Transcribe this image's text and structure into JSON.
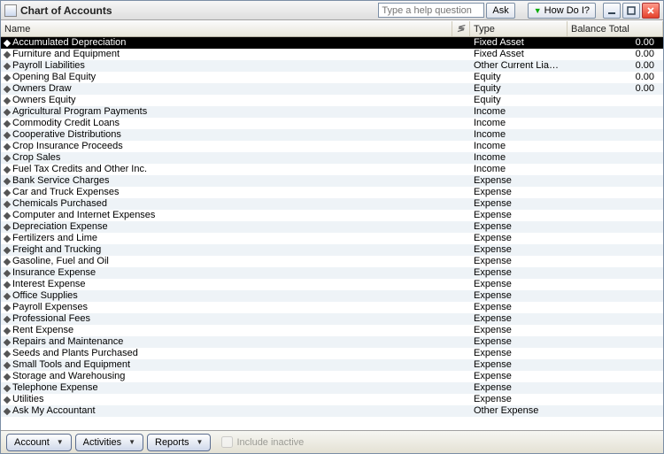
{
  "title": "Chart of Accounts",
  "help_placeholder": "Type a help question",
  "ask_label": "Ask",
  "howdo_label": "How Do I?",
  "columns": {
    "name": "Name",
    "type": "Type",
    "balance": "Balance Total"
  },
  "footer": {
    "account": "Account",
    "activities": "Activities",
    "reports": "Reports",
    "include_inactive": "Include inactive"
  },
  "accounts": [
    {
      "name": "Accumulated Depreciation",
      "type": "Fixed Asset",
      "balance": "0.00",
      "selected": true
    },
    {
      "name": "Furniture and Equipment",
      "type": "Fixed Asset",
      "balance": "0.00"
    },
    {
      "name": "Payroll Liabilities",
      "type": "Other Current Liabi...",
      "balance": "0.00"
    },
    {
      "name": "Opening Bal Equity",
      "type": "Equity",
      "balance": "0.00"
    },
    {
      "name": "Owners Draw",
      "type": "Equity",
      "balance": "0.00"
    },
    {
      "name": "Owners Equity",
      "type": "Equity",
      "balance": ""
    },
    {
      "name": "Agricultural Program Payments",
      "type": "Income",
      "balance": ""
    },
    {
      "name": "Commodity Credit Loans",
      "type": "Income",
      "balance": ""
    },
    {
      "name": "Cooperative Distributions",
      "type": "Income",
      "balance": ""
    },
    {
      "name": "Crop Insurance Proceeds",
      "type": "Income",
      "balance": ""
    },
    {
      "name": "Crop Sales",
      "type": "Income",
      "balance": ""
    },
    {
      "name": "Fuel Tax Credits and Other Inc.",
      "type": "Income",
      "balance": ""
    },
    {
      "name": "Bank Service Charges",
      "type": "Expense",
      "balance": ""
    },
    {
      "name": "Car and Truck Expenses",
      "type": "Expense",
      "balance": ""
    },
    {
      "name": "Chemicals Purchased",
      "type": "Expense",
      "balance": ""
    },
    {
      "name": "Computer and Internet Expenses",
      "type": "Expense",
      "balance": ""
    },
    {
      "name": "Depreciation Expense",
      "type": "Expense",
      "balance": ""
    },
    {
      "name": "Fertilizers and Lime",
      "type": "Expense",
      "balance": ""
    },
    {
      "name": "Freight and Trucking",
      "type": "Expense",
      "balance": ""
    },
    {
      "name": "Gasoline, Fuel and Oil",
      "type": "Expense",
      "balance": ""
    },
    {
      "name": "Insurance Expense",
      "type": "Expense",
      "balance": ""
    },
    {
      "name": "Interest Expense",
      "type": "Expense",
      "balance": ""
    },
    {
      "name": "Office Supplies",
      "type": "Expense",
      "balance": ""
    },
    {
      "name": "Payroll Expenses",
      "type": "Expense",
      "balance": ""
    },
    {
      "name": "Professional Fees",
      "type": "Expense",
      "balance": ""
    },
    {
      "name": "Rent Expense",
      "type": "Expense",
      "balance": ""
    },
    {
      "name": "Repairs and Maintenance",
      "type": "Expense",
      "balance": ""
    },
    {
      "name": "Seeds and Plants Purchased",
      "type": "Expense",
      "balance": ""
    },
    {
      "name": "Small Tools and Equipment",
      "type": "Expense",
      "balance": ""
    },
    {
      "name": "Storage and Warehousing",
      "type": "Expense",
      "balance": ""
    },
    {
      "name": "Telephone Expense",
      "type": "Expense",
      "balance": ""
    },
    {
      "name": "Utilities",
      "type": "Expense",
      "balance": ""
    },
    {
      "name": "Ask My Accountant",
      "type": "Other Expense",
      "balance": ""
    }
  ]
}
